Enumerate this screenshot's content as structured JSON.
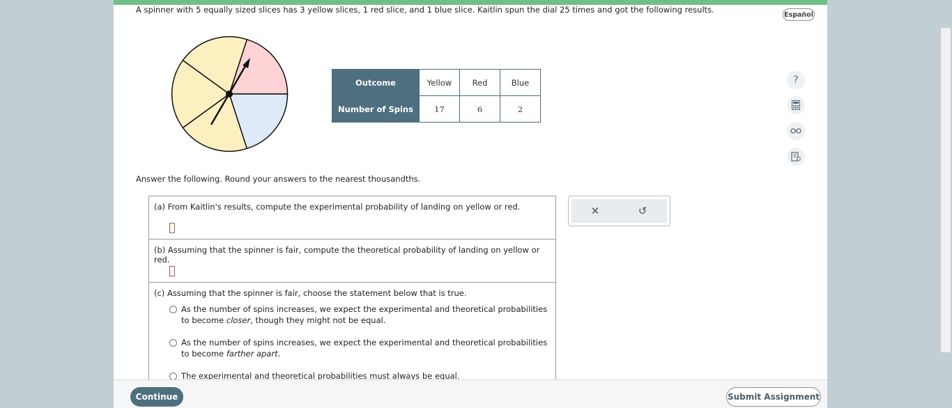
{
  "problem": {
    "prompt": "A spinner with 5 equally sized slices has 3 yellow slices, 1 red slice, and 1 blue slice. Kaitlin spun the dial 25 times and got the following results.",
    "language_button": "Español"
  },
  "results_table": {
    "header_outcome": "Outcome",
    "outcomes": [
      "Yellow",
      "Red",
      "Blue"
    ],
    "row_label": "Number of Spins",
    "counts": [
      "17",
      "6",
      "2"
    ]
  },
  "spinner": {
    "colors": {
      "yellow": "#fdf0c0",
      "red": "#fdd3d6",
      "blue": "#deeaf7"
    }
  },
  "instructions": "Answer the following. Round your answers to the nearest thousandths.",
  "parts": {
    "a": {
      "label": "(a) From Kaitlin's results, compute the experimental probability of landing on yellow or red."
    },
    "b": {
      "label": "(b) Assuming that the spinner is fair, compute the theoretical probability of landing on yellow or red."
    },
    "c": {
      "label": "(c) Assuming that the spinner is fair, choose the statement below that is true.",
      "option1_pre": "As the number of spins increases, we expect the experimental and theoretical probabilities to become ",
      "option1_em": "closer",
      "option1_post": ", though they might not be equal.",
      "option2_pre": "As the number of spins increases, we expect the experimental and theoretical probabilities to become ",
      "option2_em": "farther apart",
      "option2_post": ".",
      "option3": "The experimental and theoretical probabilities must always be equal."
    }
  },
  "toolbox": {
    "clear_icon": "✕",
    "undo_icon": "↺"
  },
  "side_tools": {
    "help_icon": "?"
  },
  "footer": {
    "continue_label": "Continue",
    "submit_label": "Submit Assignment"
  },
  "theme": {
    "accent": "#4d6f7e",
    "progress": "#6fbf86"
  }
}
